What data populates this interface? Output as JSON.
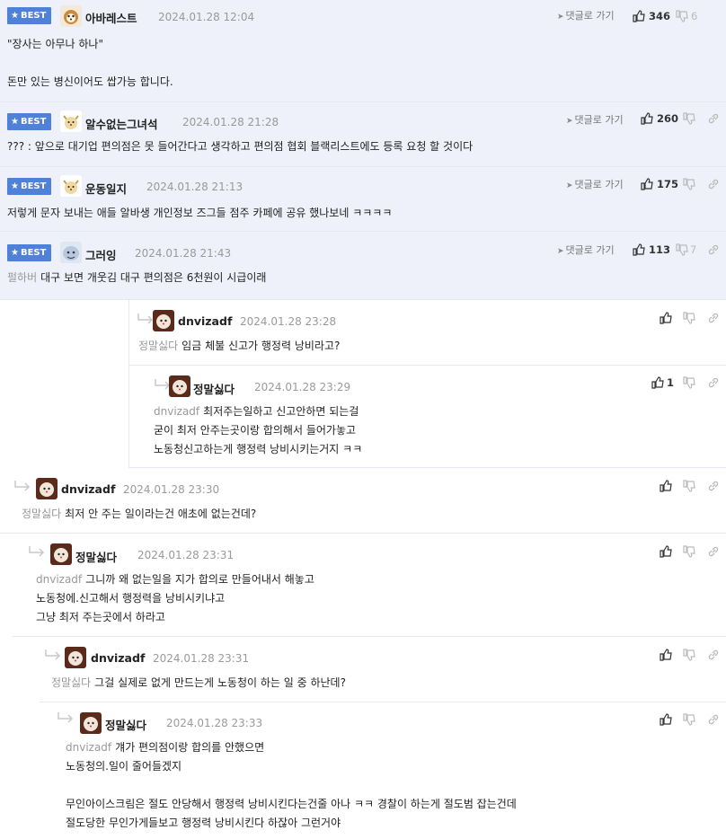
{
  "labels": {
    "best": "BEST",
    "goto_comment": "댓글로 가기"
  },
  "colors": {
    "best_bg": "#eef1f9",
    "badge": "#4f81d8",
    "muted": "#9a9a9a",
    "mention": "#999999"
  },
  "comments": [
    {
      "best": true,
      "user": "아바레스트",
      "date": "2024.01.28 12:04",
      "upvotes": "346",
      "downvotes": "6",
      "lines": [
        "\"장사는 아무나 하나\"",
        "",
        "돈만 있는 병신이어도 쌉가능 합니다."
      ],
      "mention": ""
    },
    {
      "best": true,
      "user": "알수없는그녀석",
      "date": "2024.01.28 21:28",
      "upvotes": "260",
      "downvotes": "",
      "lines": [
        "??? : 앞으로 대기업 편의점은 못 들어간다고 생각하고 편의점 협회 블랙리스트에도 등록 요청 할 것이다"
      ],
      "mention": ""
    },
    {
      "best": true,
      "user": "운동일지",
      "date": "2024.01.28 21:13",
      "upvotes": "175",
      "downvotes": "",
      "lines": [
        "저렇게 문자 보내는 애들 알바생 개인정보 즈그들 점주 카페에 공유 했나보네 ㅋㅋㅋㅋ"
      ],
      "mention": ""
    },
    {
      "best": true,
      "user": "그러잉",
      "date": "2024.01.28 21:43",
      "upvotes": "113",
      "downvotes": "7",
      "mention": "펄하버",
      "lines": [
        "대구 보면 개웃김 대구 편의점은 6천원이 시급이래"
      ]
    },
    {
      "best": false,
      "user": "dnvizadf",
      "date": "2024.01.28 23:28",
      "upvotes": "",
      "downvotes": "",
      "mention": "정말싫다",
      "lines": [
        "임금 체불 신고가 행정력 낭비라고?"
      ]
    },
    {
      "best": false,
      "user": "정말싫다",
      "date": "2024.01.28 23:29",
      "upvotes": "1",
      "downvotes": "",
      "mention": "dnvizadf",
      "lines": [
        "최저주는일하고 신고안하면 되는걸",
        "굳이 최저 안주는곳이랑 합의해서 들어가놓고",
        "노동청신고하는게 행정력 낭비시키는거지 ㅋㅋ"
      ]
    },
    {
      "best": false,
      "user": "dnvizadf",
      "date": "2024.01.28 23:30",
      "upvotes": "",
      "downvotes": "",
      "mention": "정말싫다",
      "lines": [
        "최저 안 주는 일이라는건 애초에 없는건데?"
      ]
    },
    {
      "best": false,
      "user": "정말싫다",
      "date": "2024.01.28 23:31",
      "upvotes": "",
      "downvotes": "",
      "mention": "dnvizadf",
      "lines": [
        "그니까 왜 없는일을 지가 합의로 만들어내서 해놓고",
        "노동청에.신고해서 행정력을 낭비시키냐고",
        "그냥 최저 주는곳에서 하라고"
      ]
    },
    {
      "best": false,
      "user": "dnvizadf",
      "date": "2024.01.28 23:31",
      "upvotes": "",
      "downvotes": "",
      "mention": "정말싫다",
      "lines": [
        "그걸 실제로 없게 만드는게 노동청이 하는 일 중 하난데?"
      ]
    },
    {
      "best": false,
      "user": "정말싫다",
      "date": "2024.01.28 23:33",
      "upvotes": "",
      "downvotes": "",
      "mention": "dnvizadf",
      "lines": [
        "걔가 편의점이랑 합의를 안했으면",
        "노동청의.일이 줄어들겠지",
        "",
        "무인아이스크림은 절도 안당해서 행정력 낭비시킨다는건줄 아나 ㅋㅋ 경찰이 하는게 절도범 잡는건데",
        "절도당한 무인가게들보고 행정력 낭비시킨다 하잖아 그런거야"
      ]
    }
  ]
}
